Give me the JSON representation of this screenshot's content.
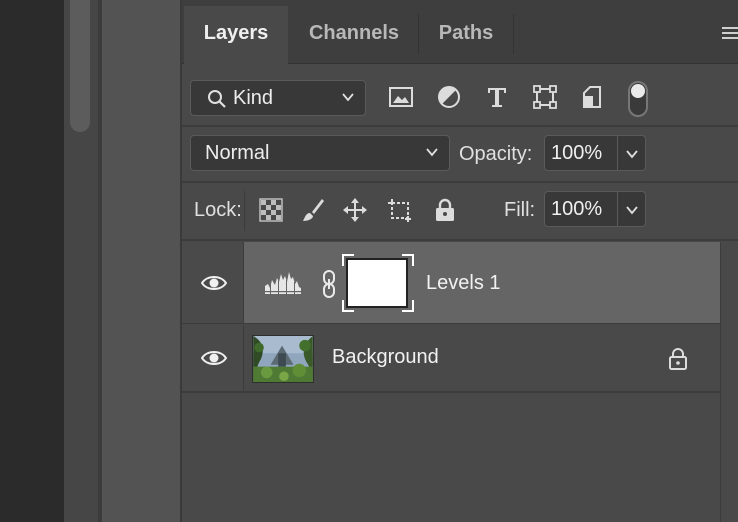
{
  "tabs": [
    {
      "label": "Layers",
      "active": true
    },
    {
      "label": "Channels",
      "active": false
    },
    {
      "label": "Paths",
      "active": false
    }
  ],
  "filter": {
    "label": "Kind",
    "icons": [
      "image-filter-icon",
      "adjustment-filter-icon",
      "type-filter-icon",
      "shape-filter-icon",
      "smart-object-filter-icon"
    ]
  },
  "blend": {
    "mode": "Normal",
    "opacity_label": "Opacity:",
    "opacity_value": "100%"
  },
  "lock": {
    "label": "Lock:",
    "fill_label": "Fill:",
    "fill_value": "100%"
  },
  "layers": [
    {
      "name": "Levels 1",
      "type": "adjustment",
      "selected": true,
      "visible": true
    },
    {
      "name": "Background",
      "type": "pixel",
      "selected": false,
      "visible": true,
      "locked": true
    }
  ],
  "colors": {
    "panel": "#494949",
    "selected_layer": "#656565",
    "tabbar": "#3e3e3e"
  }
}
